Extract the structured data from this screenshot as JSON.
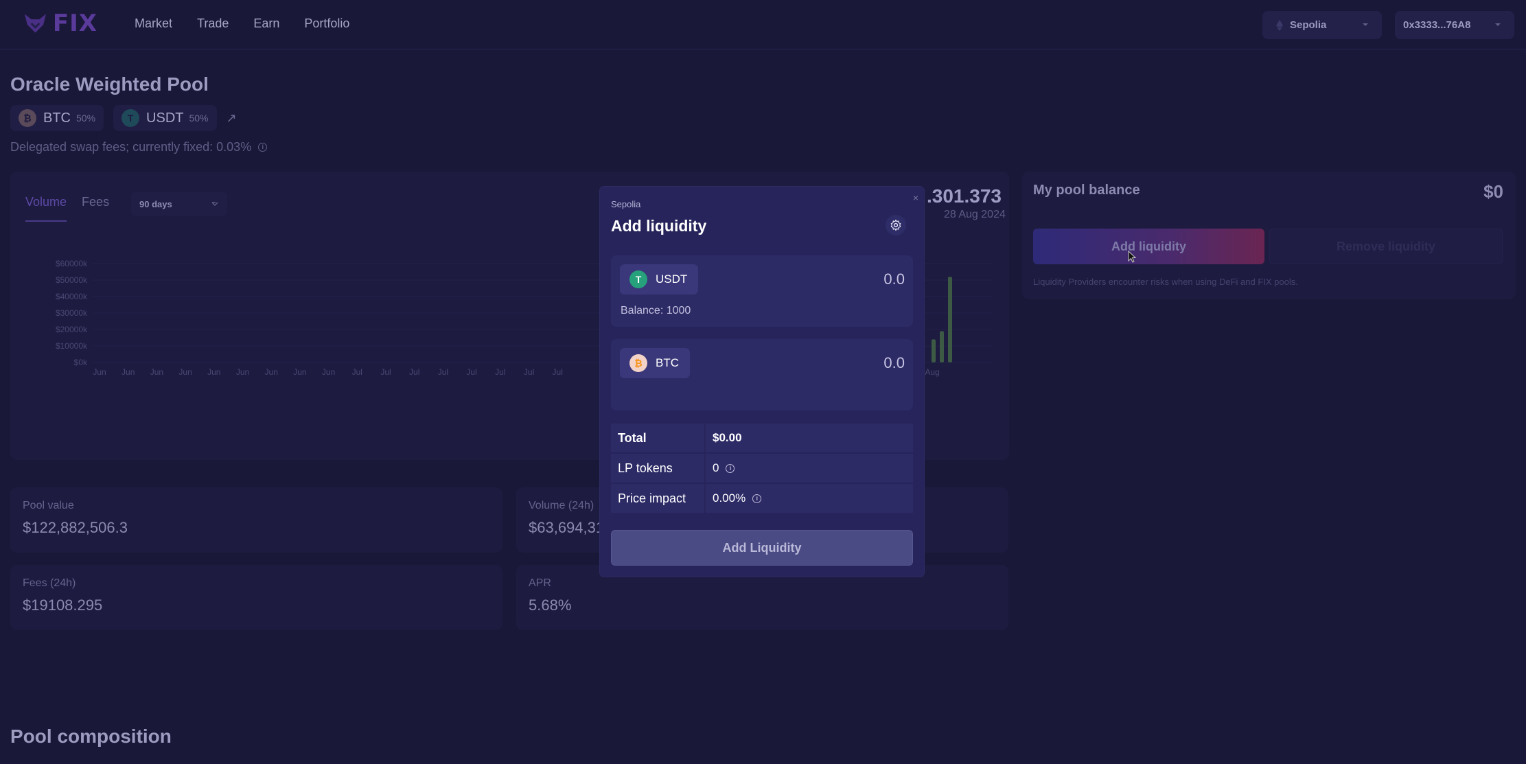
{
  "header": {
    "logo_text": "FIX",
    "nav": [
      "Market",
      "Trade",
      "Earn",
      "Portfolio"
    ],
    "network": "Sepolia",
    "wallet": "0x3333...76A8"
  },
  "pool": {
    "title": "Oracle Weighted Pool",
    "tokens": [
      {
        "symbol": "BTC",
        "weight": "50%"
      },
      {
        "symbol": "USDT",
        "weight": "50%"
      }
    ],
    "fees_note": "Delegated swap fees; currently fixed: 0.03%"
  },
  "chart_panel": {
    "tabs": [
      "Volume",
      "Fees"
    ],
    "range": "90 days",
    "headline_value": ".301.373",
    "headline_date": "28 Aug 2024"
  },
  "chart_data": {
    "type": "bar",
    "ylim": [
      0,
      60000
    ],
    "y_tick_labels": [
      "$60000k",
      "$50000k",
      "$40000k",
      "$30000k",
      "$20000k",
      "$10000k",
      "$0k"
    ],
    "x_tick_labels": [
      "Jun",
      "Jun",
      "Jun",
      "Jun",
      "Jun",
      "Jun",
      "Jun",
      "Jun",
      "Jun",
      "Jul",
      "Jul",
      "Jul",
      "Jul",
      "Jul",
      "Jul",
      "Jul",
      "Jul",
      "Aug"
    ],
    "visible_bar_values": [
      14000,
      19000,
      52000
    ]
  },
  "stats": {
    "pool_value": {
      "label": "Pool value",
      "value": "$122,882,506.3"
    },
    "volume_24h": {
      "label": "Volume (24h)",
      "value": "$63,694,31"
    },
    "fees_24h": {
      "label": "Fees (24h)",
      "value": "$19108.295"
    },
    "apr": {
      "label": "APR",
      "value": "5.68%"
    }
  },
  "balance": {
    "title": "My pool balance",
    "value": "$0",
    "add_label": "Add liquidity",
    "remove_label": "Remove liquidity",
    "note": "Liquidity Providers encounter risks when using DeFi and FIX pools."
  },
  "composition_title": "Pool composition",
  "modal": {
    "network": "Sepolia",
    "title": "Add liquidity",
    "close": "×",
    "inputs": [
      {
        "symbol": "USDT",
        "placeholder": "0.0",
        "balance": "Balance: 1000"
      },
      {
        "symbol": "BTC",
        "placeholder": "0.0"
      }
    ],
    "summary": {
      "total_label": "Total",
      "total_value": "$0.00",
      "lp_label": "LP tokens",
      "lp_value": "0",
      "impact_label": "Price impact",
      "impact_value": "0.00%"
    },
    "submit": "Add Liquidity"
  },
  "colors": {
    "background": "#1a1838",
    "modal": "#26245a",
    "usdt": "#26a17b",
    "btc": "#f7931a",
    "accent_gradient_start": "#2e2a78",
    "accent_gradient_end": "#6a2552"
  }
}
